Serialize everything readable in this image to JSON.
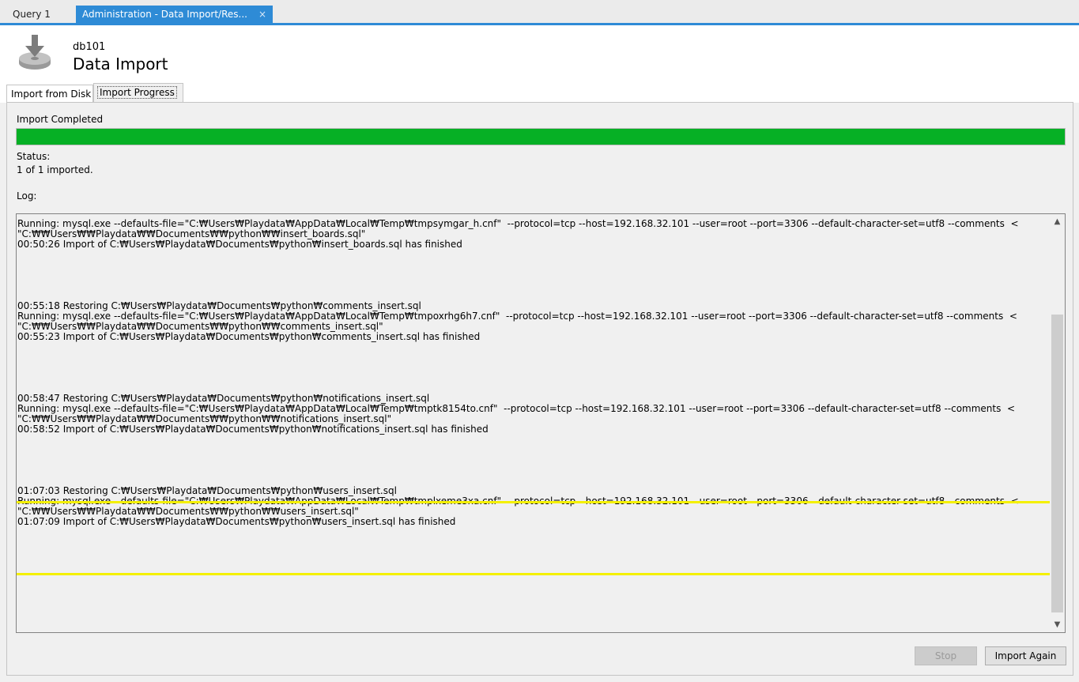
{
  "tabs": {
    "query": "Query 1",
    "admin": "Administration - Data Import/Res...",
    "close_glyph": "×"
  },
  "header": {
    "db_name": "db101",
    "title": "Data Import",
    "icon": "import-disk-icon"
  },
  "subtabs": {
    "import_from_disk": "Import from Disk",
    "import_progress": "Import Progress"
  },
  "progress": {
    "label": "Import Completed",
    "percent": 100,
    "color": "#06b025"
  },
  "status": {
    "label": "Status:",
    "value": "1 of 1 imported."
  },
  "log": {
    "label": "Log:",
    "text": "Running: mysql.exe --defaults-file=\"C:₩Users₩Playdata₩AppData₩Local₩Temp₩tmpsymgar_h.cnf\"  --protocol=tcp --host=192.168.32.101 --user=root --port=3306 --default-character-set=utf8 --comments  <\n\"C:₩₩Users₩₩Playdata₩₩Documents₩₩python₩₩insert_boards.sql\"\n00:50:26 Import of C:₩Users₩Playdata₩Documents₩python₩insert_boards.sql has finished\n\n\n\n\n\n00:55:18 Restoring C:₩Users₩Playdata₩Documents₩python₩comments_insert.sql\nRunning: mysql.exe --defaults-file=\"C:₩Users₩Playdata₩AppData₩Local₩Temp₩tmpoxrhg6h7.cnf\"  --protocol=tcp --host=192.168.32.101 --user=root --port=3306 --default-character-set=utf8 --comments  <\n\"C:₩₩Users₩₩Playdata₩₩Documents₩₩python₩₩comments_insert.sql\"\n00:55:23 Import of C:₩Users₩Playdata₩Documents₩python₩comments_insert.sql has finished\n\n\n\n\n\n00:58:47 Restoring C:₩Users₩Playdata₩Documents₩python₩notifications_insert.sql\nRunning: mysql.exe --defaults-file=\"C:₩Users₩Playdata₩AppData₩Local₩Temp₩tmptk8154to.cnf\"  --protocol=tcp --host=192.168.32.101 --user=root --port=3306 --default-character-set=utf8 --comments  <\n\"C:₩₩Users₩₩Playdata₩₩Documents₩₩python₩₩notifications_insert.sql\"\n00:58:52 Import of C:₩Users₩Playdata₩Documents₩python₩notifications_insert.sql has finished\n\n\n\n\n\n01:07:03 Restoring C:₩Users₩Playdata₩Documents₩python₩users_insert.sql\nRunning: mysql.exe --defaults-file=\"C:₩Users₩Playdata₩AppData₩Local₩Temp₩tmplxeme3xa.cnf\"  --protocol=tcp --host=192.168.32.101 --user=root --port=3306 --default-character-set=utf8 --comments  <\n\"C:₩₩Users₩₩Playdata₩₩Documents₩₩python₩₩users_insert.sql\"\n01:07:09 Import of C:₩Users₩Playdata₩Documents₩python₩users_insert.sql has finished",
    "highlight_color": "#f4f000"
  },
  "buttons": {
    "stop": "Stop",
    "import_again": "Import Again"
  },
  "colors": {
    "accent": "#2e8bd6"
  }
}
